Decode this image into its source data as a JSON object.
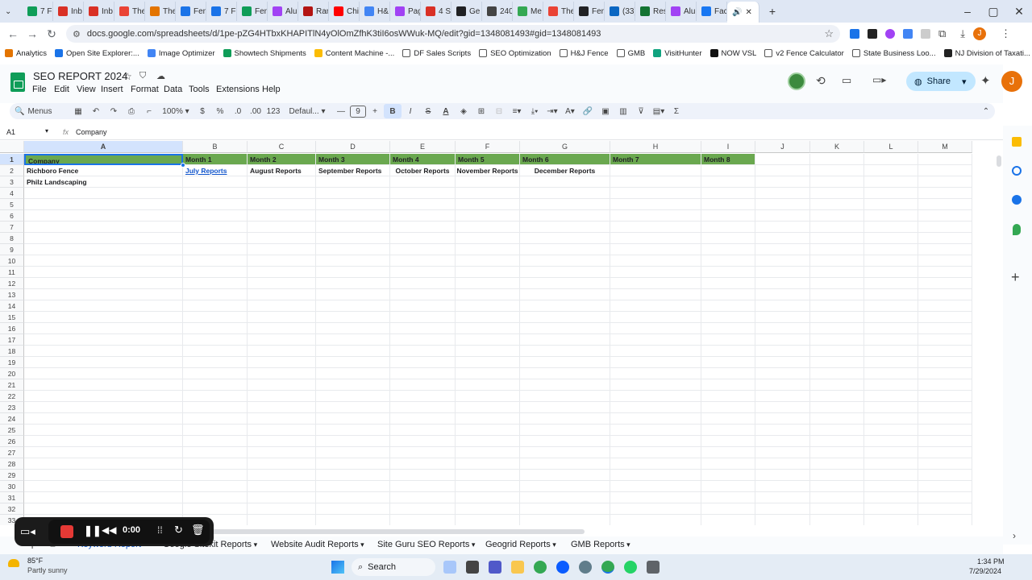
{
  "browser": {
    "tabs": [
      "7 Fi",
      "Inb",
      "Inb",
      "The",
      "The",
      "Fen",
      "7 Fi",
      "Fen",
      "Alu",
      "Ran",
      "Chi",
      "H&",
      "Pag",
      "4 S",
      "Ge",
      "240",
      "Me",
      "The",
      "Fen",
      "(33)",
      "Res",
      "Alu",
      "Face"
    ],
    "url": "docs.google.com/spreadsheets/d/1pe-pZG4HTbxKHAPITlN4yOlOmZfhK3tiI6osWWuk-MQ/edit?gid=1348081493#gid=1348081493",
    "avatar_letter": "J"
  },
  "bookmarks": [
    "Analytics",
    "Open Site Explorer:...",
    "Image Optimizer",
    "Showtech Shipments",
    "Content Machine -...",
    "DF Sales Scripts",
    "SEO Optimization",
    "H&J Fence",
    "GMB",
    "VisitHunter",
    "NOW VSL",
    "v2 Fence Calculator",
    "State Business Loo...",
    "NJ Division of Taxati..."
  ],
  "app": {
    "title": "SEO REPORT 2024",
    "menus": [
      "File",
      "Edit",
      "View",
      "Insert",
      "Format",
      "Data",
      "Tools",
      "Extensions",
      "Help"
    ],
    "share_label": "Share",
    "avatar_letter": "J"
  },
  "toolbar": {
    "search_label": "Menus",
    "zoom": "100%",
    "currency": "$",
    "percent": "%",
    "dec_less": ".0",
    "dec_more": ".00",
    "number_format": "123",
    "font": "Defaul...",
    "font_size": "9",
    "bold": "B",
    "italic": "I",
    "strike": "S",
    "text_color": "A",
    "sum": "Σ"
  },
  "formula_bar": {
    "cell_ref": "A1",
    "fx": "fx",
    "content": "Company"
  },
  "grid": {
    "columns": [
      "A",
      "B",
      "C",
      "D",
      "E",
      "F",
      "G",
      "H",
      "I",
      "J",
      "K",
      "L",
      "M"
    ],
    "rows": [
      "1",
      "2",
      "3",
      "4",
      "5",
      "6",
      "7",
      "8",
      "9",
      "10",
      "11",
      "12",
      "13",
      "14",
      "15",
      "16",
      "17",
      "18",
      "19",
      "20",
      "21",
      "22",
      "23",
      "24",
      "25",
      "26",
      "27",
      "28",
      "29",
      "30",
      "31",
      "32",
      "33"
    ],
    "row1": [
      "Company",
      "Month 1",
      "Month 2",
      "Month 3",
      "Month 4",
      "Month 5",
      "Month 6",
      "Month 7",
      "Month 8"
    ],
    "row2": [
      "Richboro Fence",
      "July Reports",
      "August Reports",
      "September Reports",
      "October Reports",
      "November Reports",
      "December Reports"
    ],
    "row3": [
      "Philz Landscaping"
    ]
  },
  "sheet_tabs": [
    "Keyword Report",
    "Google Sitekit Reports",
    "Website Audit Reports",
    "Site Guru SEO Reports",
    "Geogrid Reports",
    "GMB Reports"
  ],
  "recorder": {
    "time": "0:00"
  },
  "taskbar": {
    "temp": "85°F",
    "weather": "Partly sunny",
    "search": "Search",
    "time": "1:34 PM",
    "date": "7/29/2024"
  },
  "colors": {
    "header_green": "#6aa84f",
    "link_blue": "#1155cc",
    "share_bg": "#c2e7ff",
    "selection": "#1a73e8"
  }
}
